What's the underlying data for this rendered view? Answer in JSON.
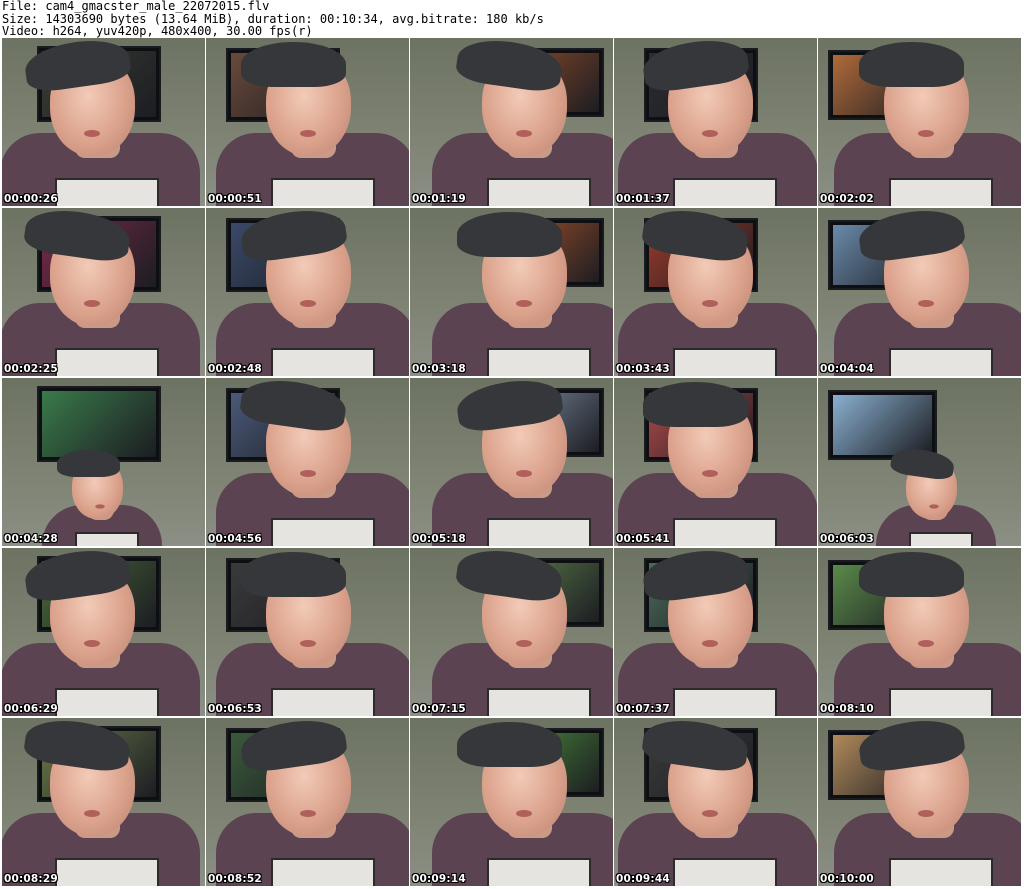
{
  "header": {
    "line1": "File: cam4_gmacster_male_22072015.flv",
    "line2": "Size: 14303690 bytes (13.64 MiB), duration: 00:10:34, avg.bitrate: 180 kb/s",
    "line3": "Video: h264, yuv420p, 480x400, 30.00 fps(r)"
  },
  "thumbnails": [
    {
      "timestamp": "00:00:26",
      "tv": "#3a3d33"
    },
    {
      "timestamp": "00:00:51",
      "tv": "#6a4a3a"
    },
    {
      "timestamp": "00:01:19",
      "tv": "#8a4a2a"
    },
    {
      "timestamp": "00:01:37",
      "tv": "#2a2c30"
    },
    {
      "timestamp": "00:02:02",
      "tv": "#b06a3a"
    },
    {
      "timestamp": "00:02:25",
      "tv": "#7a2a4a"
    },
    {
      "timestamp": "00:02:48",
      "tv": "#3a4a6a"
    },
    {
      "timestamp": "00:03:18",
      "tv": "#a0502a"
    },
    {
      "timestamp": "00:03:43",
      "tv": "#9a3a2a"
    },
    {
      "timestamp": "00:04:04",
      "tv": "#6a8aaa"
    },
    {
      "timestamp": "00:04:28",
      "tv": "#3a7a4a"
    },
    {
      "timestamp": "00:04:56",
      "tv": "#4a5a7a"
    },
    {
      "timestamp": "00:05:18",
      "tv": "#7a8aa0"
    },
    {
      "timestamp": "00:05:41",
      "tv": "#b04a4a"
    },
    {
      "timestamp": "00:06:03",
      "tv": "#8ab0d0"
    },
    {
      "timestamp": "00:06:29",
      "tv": "#4a6a3a"
    },
    {
      "timestamp": "00:06:53",
      "tv": "#3a3a3a"
    },
    {
      "timestamp": "00:07:15",
      "tv": "#5a7a4a"
    },
    {
      "timestamp": "00:07:37",
      "tv": "#4a6a5a"
    },
    {
      "timestamp": "00:08:10",
      "tv": "#5a8a4a"
    },
    {
      "timestamp": "00:08:29",
      "tv": "#6a7a4a"
    },
    {
      "timestamp": "00:08:52",
      "tv": "#3a5a3a"
    },
    {
      "timestamp": "00:09:14",
      "tv": "#4a8a3a"
    },
    {
      "timestamp": "00:09:44",
      "tv": "#3a3a3a"
    },
    {
      "timestamp": "00:10:00",
      "tv": "#b08a5a"
    }
  ]
}
